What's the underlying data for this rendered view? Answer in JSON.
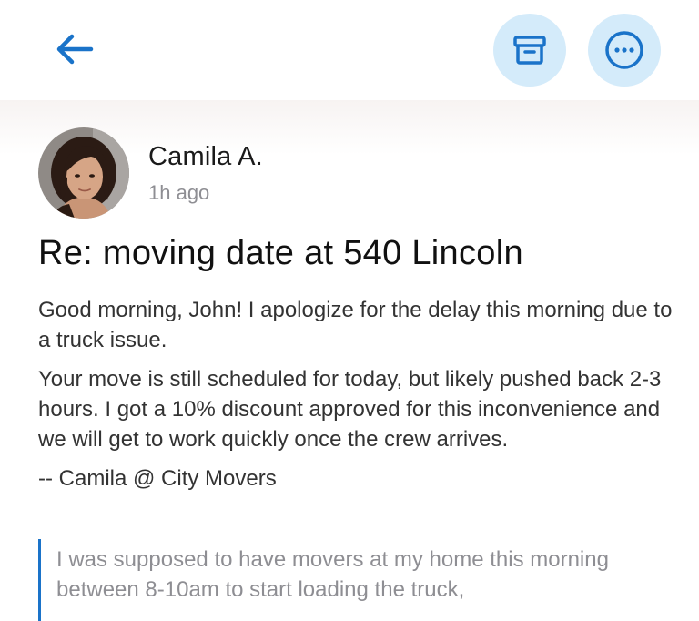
{
  "header": {
    "back_icon": "arrow-left-icon",
    "archive_icon": "archive-icon",
    "more_icon": "more-horizontal-icon",
    "accent_color": "#1a73c9",
    "button_bg_color": "#d4ebfa"
  },
  "message": {
    "sender": "Camila A.",
    "time": "1h ago",
    "subject": "Re: moving date at 540 Lincoln",
    "paragraphs": [
      "Good morning, John! I apologize for the delay this morning due to a truck issue.",
      "Your move is still scheduled for today, but likely pushed back 2-3 hours. I got a 10% discount approved for this inconvenience and we will get to work quickly once the crew arrives."
    ],
    "signature": "-- Camila @ City Movers",
    "quoted_text": "I was supposed to have movers at my home this morning between 8-10am to start loading the truck,"
  }
}
